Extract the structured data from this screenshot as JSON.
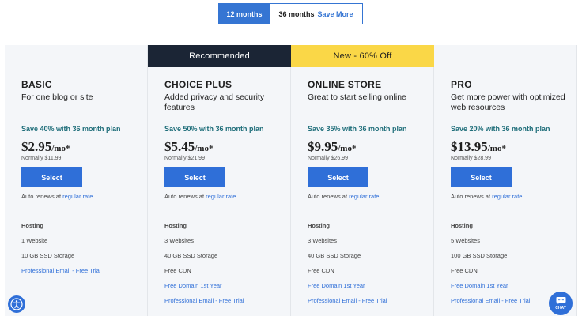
{
  "toggle": {
    "term_12": "12 months",
    "term_36": "36 months",
    "term_36_save": "Save More"
  },
  "plans": [
    {
      "ribbon": "",
      "name": "BASIC",
      "description": "For one blog or site",
      "promo": "Save 40% with 36 month plan",
      "price": "$2.95",
      "unit": "/mo*",
      "normally": "Normally $11.99",
      "select_label": "Select",
      "renew_prefix": "Auto renews at",
      "renew_link": "regular rate",
      "hosting_label": "Hosting",
      "features": [
        {
          "text": "1 Website",
          "link": false
        },
        {
          "text": "10 GB SSD Storage",
          "link": false
        },
        {
          "text": "Professional Email - Free Trial",
          "link": true
        }
      ]
    },
    {
      "ribbon": "Recommended",
      "name": "CHOICE PLUS",
      "description": "Added privacy and security features",
      "promo": "Save 50% with 36 month plan",
      "price": "$5.45",
      "unit": "/mo*",
      "normally": "Normally $21.99",
      "select_label": "Select",
      "renew_prefix": "Auto renews at",
      "renew_link": "regular rate",
      "hosting_label": "Hosting",
      "features": [
        {
          "text": "3 Websites",
          "link": false
        },
        {
          "text": "40 GB SSD Storage",
          "link": false
        },
        {
          "text": "Free CDN",
          "link": false
        },
        {
          "text": "Free Domain 1st Year",
          "link": true
        },
        {
          "text": "Professional Email - Free Trial",
          "link": true
        }
      ]
    },
    {
      "ribbon": "New - 60% Off",
      "name": "ONLINE STORE",
      "description": "Great to start selling online",
      "promo": "Save 35% with 36 month plan",
      "price": "$9.95",
      "unit": "/mo*",
      "normally": "Normally $26.99",
      "select_label": "Select",
      "renew_prefix": "Auto renews at",
      "renew_link": "regular rate",
      "hosting_label": "Hosting",
      "features": [
        {
          "text": "3 Websites",
          "link": false
        },
        {
          "text": "40 GB SSD Storage",
          "link": false
        },
        {
          "text": "Free CDN",
          "link": false
        },
        {
          "text": "Free Domain 1st Year",
          "link": true
        },
        {
          "text": "Professional Email - Free Trial",
          "link": true
        }
      ]
    },
    {
      "ribbon": "",
      "name": "PRO",
      "description": "Get more power with optimized web resources",
      "promo": "Save 20% with 36 month plan",
      "price": "$13.95",
      "unit": "/mo*",
      "normally": "Normally $28.99",
      "select_label": "Select",
      "renew_prefix": "Auto renews at",
      "renew_link": "regular rate",
      "hosting_label": "Hosting",
      "features": [
        {
          "text": "5 Websites",
          "link": false
        },
        {
          "text": "100 GB SSD Storage",
          "link": false
        },
        {
          "text": "Free CDN",
          "link": false
        },
        {
          "text": "Free Domain 1st Year",
          "link": true
        },
        {
          "text": "Professional Email - Free Trial",
          "link": true
        }
      ]
    }
  ],
  "widgets": {
    "accessibility_icon": "accessibility-icon",
    "chat_label": "CHAT"
  },
  "colors": {
    "accent": "#2f6fd8",
    "ribbon_dark": "#1b2535",
    "ribbon_yellow": "#fad747",
    "promo": "#1f6e7a"
  }
}
